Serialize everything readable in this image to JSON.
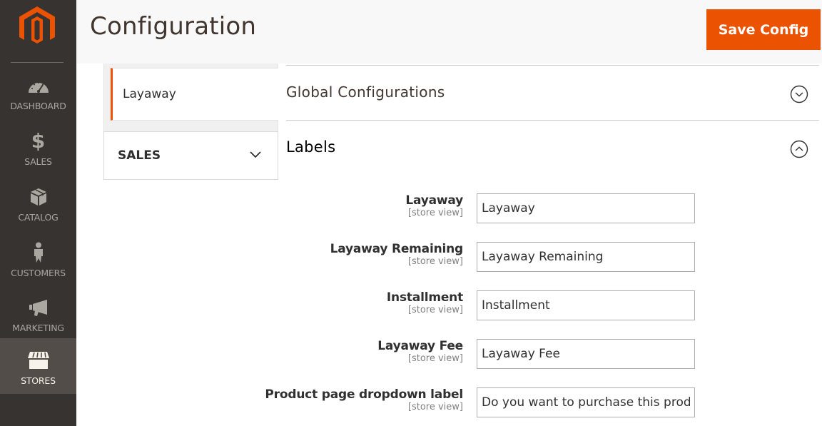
{
  "sidebar": {
    "logo": "magento-logo",
    "items": [
      {
        "label": "DASHBOARD",
        "icon": "dashboard-gauge-icon",
        "active": false
      },
      {
        "label": "SALES",
        "icon": "dollar-icon",
        "active": false
      },
      {
        "label": "CATALOG",
        "icon": "box-icon",
        "active": false
      },
      {
        "label": "CUSTOMERS",
        "icon": "person-icon",
        "active": false
      },
      {
        "label": "MARKETING",
        "icon": "megaphone-icon",
        "active": false
      },
      {
        "label": "STORES",
        "icon": "storefront-icon",
        "active": true
      }
    ]
  },
  "header": {
    "title": "Configuration",
    "save_label": "Save Config"
  },
  "config_tabs": {
    "active_item": "Layaway",
    "groups": [
      {
        "label": "SALES",
        "expanded": false,
        "icon": "chevron-down-icon"
      }
    ]
  },
  "sections": [
    {
      "title": "Global Configurations",
      "expanded": false,
      "icon": "circle-chevron-down-icon"
    },
    {
      "title": "Labels",
      "expanded": true,
      "icon": "circle-chevron-up-icon"
    }
  ],
  "labels_form": {
    "scope_text": "[store view]",
    "fields": [
      {
        "label": "Layaway",
        "value": "Layaway"
      },
      {
        "label": "Layaway Remaining",
        "value": "Layaway Remaining"
      },
      {
        "label": "Installment",
        "value": "Installment"
      },
      {
        "label": "Layaway Fee",
        "value": "Layaway Fee"
      },
      {
        "label": "Product page dropdown label",
        "value": "Do you want to purchase this produ"
      }
    ]
  },
  "colors": {
    "brand_orange": "#eb5202",
    "sidebar_bg": "#373330",
    "sidebar_active_bg": "#524d49"
  }
}
